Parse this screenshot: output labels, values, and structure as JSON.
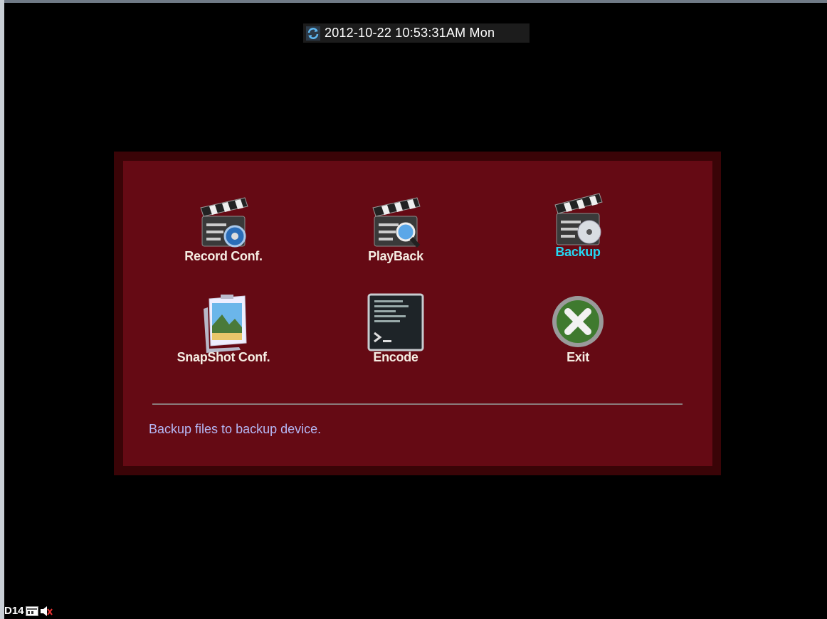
{
  "datetime": {
    "text": "2012-10-22 10:53:31AM Mon",
    "icon": "sync-icon"
  },
  "menu": {
    "items": [
      {
        "id": "record_conf",
        "label": "Record Conf.",
        "icon": "clapper-gear-icon",
        "active": false
      },
      {
        "id": "playback",
        "label": "PlayBack",
        "icon": "clapper-magnifier-icon",
        "active": false
      },
      {
        "id": "backup",
        "label": "Backup",
        "icon": "clapper-disc-icon",
        "active": true
      },
      {
        "id": "snapshot_conf",
        "label": "SnapShot Conf.",
        "icon": "photo-icon",
        "active": false
      },
      {
        "id": "encode",
        "label": "Encode",
        "icon": "terminal-icon",
        "active": false
      },
      {
        "id": "exit",
        "label": "Exit",
        "icon": "close-icon",
        "active": false
      }
    ],
    "description": "Backup files to backup device."
  },
  "status_bar": {
    "channel": "D14",
    "icons": [
      "record-status-icon",
      "audio-muted-icon"
    ]
  },
  "colors": {
    "panel": "#650a14",
    "panel_border": "#3a0407",
    "active_label": "#25d7f2",
    "description": "#b5b8f5"
  }
}
